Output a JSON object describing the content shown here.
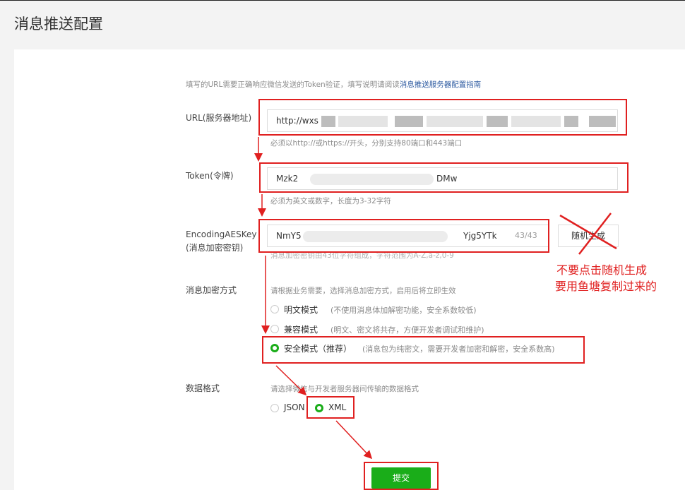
{
  "page": {
    "title": "消息推送配置"
  },
  "intro": {
    "text": "填写的URL需要正确响应微信发送的Token验证，填写说明请阅读",
    "link": "消息推送服务器配置指南"
  },
  "url_field": {
    "label": "URL(服务器地址)",
    "value": "http://wxs",
    "hint": "必须以http://或https://开头，分别支持80端口和443端口"
  },
  "token_field": {
    "label": "Token(令牌)",
    "value_start": "Mzk2",
    "value_end": "DMw",
    "hint": "必须为英文或数字，长度为3-32字符"
  },
  "aes_field": {
    "label_line1": "EncodingAESKey",
    "label_line2": "(消息加密密钥)",
    "value_start": "NmY5",
    "value_end": "Yjg5YTk",
    "counter": "43/43",
    "generate_button": "随机生成",
    "hint": "消息加密密钥由43位字符组成，字符范围为A-Z,a-z,0-9"
  },
  "encrypt_mode": {
    "label": "消息加密方式",
    "hint": "请根据业务需要，选择消息加密方式，启用后将立即生效",
    "options": [
      {
        "label": "明文模式",
        "desc": "(不使用消息体加解密功能，安全系数较低)",
        "selected": false
      },
      {
        "label": "兼容模式",
        "desc": "(明文、密文将共存，方便开发者调试和维护)",
        "selected": false
      },
      {
        "label": "安全模式（推荐）",
        "desc": "(消息包为纯密文，需要开发者加密和解密，安全系数高)",
        "selected": true
      }
    ]
  },
  "data_format": {
    "label": "数据格式",
    "hint": "请选择微信与开发者服务器间传输的数据格式",
    "options": [
      {
        "label": "JSON",
        "selected": false
      },
      {
        "label": "XML",
        "selected": true
      }
    ]
  },
  "submit_button": "提交",
  "annotation": {
    "line1": "不要点击随机生成",
    "line2": "要用鱼塘复制过来的"
  },
  "colors": {
    "accent_green": "#1aad19",
    "annotation_red": "#e02020",
    "link_blue": "#2c5aa0"
  }
}
